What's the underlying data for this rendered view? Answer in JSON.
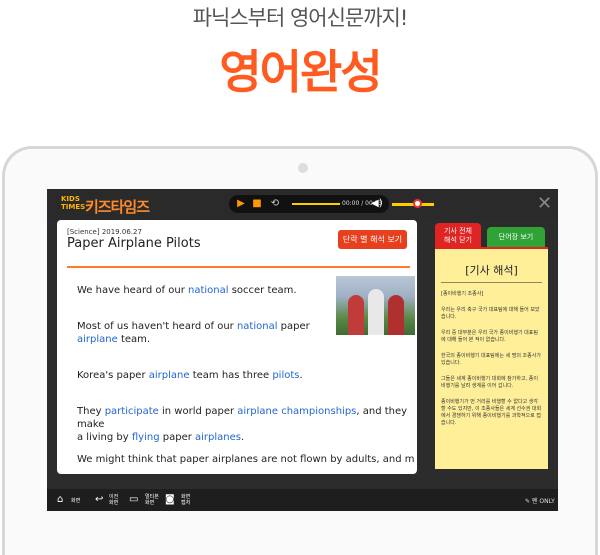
{
  "hero": {
    "subtitle": "파닉스부터 영어신문까지!",
    "title": "영어완성"
  },
  "app": {
    "logo_small_1": "KIDS",
    "logo_small_2": "TIMES",
    "logo_main": "키즈타임즈"
  },
  "player": {
    "time": "00:00 / 00:33",
    "play_icon": "play-icon",
    "stop_icon": "stop-icon",
    "repeat_icon": "repeat-icon",
    "volume_icon": "volume-icon"
  },
  "article": {
    "meta": "[Science] 2019.06.27",
    "title": "Paper Airplane Pilots",
    "interp_button": "단락 별 해석 보기",
    "paragraphs": [
      {
        "a": "We have heard of our ",
        "b": "national",
        "c": " soccer team."
      },
      {
        "a": "Most of us haven't heard of our ",
        "b": "national",
        "c": " paper",
        "d": "airplane",
        "e": " team."
      },
      {
        "a": "Korea's paper ",
        "b": "airplane",
        "c": " team has three ",
        "d": "pilots",
        "e": "."
      },
      {
        "a": "They ",
        "b": "participate",
        "c": " in world paper ",
        "d": "airplane championships",
        "e": ", and they make",
        "f": "a living by ",
        "g": "flying",
        "h": " paper ",
        "i": "airplanes",
        "j": "."
      },
      {
        "a": "We might think that paper airplanes are not flown by adults, and m"
      }
    ]
  },
  "side": {
    "tab_full_1": "기사 전체",
    "tab_full_2": "해석 닫기",
    "tab_vocab": "단어장 보기",
    "note_title": "[기사 해석]",
    "note_paragraphs": [
      "[종이비행기 조종사]",
      "우리는 우리 축구 국가 대표팀에 대해 들어 보았습니다.",
      "우리 중 대부분은 우리 국가 종이비행기 대표팀에 대해 들어 본 적이 없습니다.",
      "한국의 종이비행기 대표팀에는 세 명의 조종사가 있습니다.",
      "그들은 세계 종이비행기 대회에 참가하고, 종이비행기를 날려 생계를 이어 갑니다.",
      "종이비행기가 먼 거리를 비행할 수 없다고 생각할 수도 있지만, 이 조종사들은 세계 선수권 대회에서 경쟁하기 위해 종이비행기를 과학적으로 접습니다."
    ]
  },
  "bottom": {
    "home": "화면",
    "back_1": "이전",
    "back_2": "화면",
    "next_1": "멀티본",
    "next_2": "화면",
    "capture_1": "화면",
    "capture_2": "캡처",
    "pen": "✎ 펜 ONLY"
  }
}
